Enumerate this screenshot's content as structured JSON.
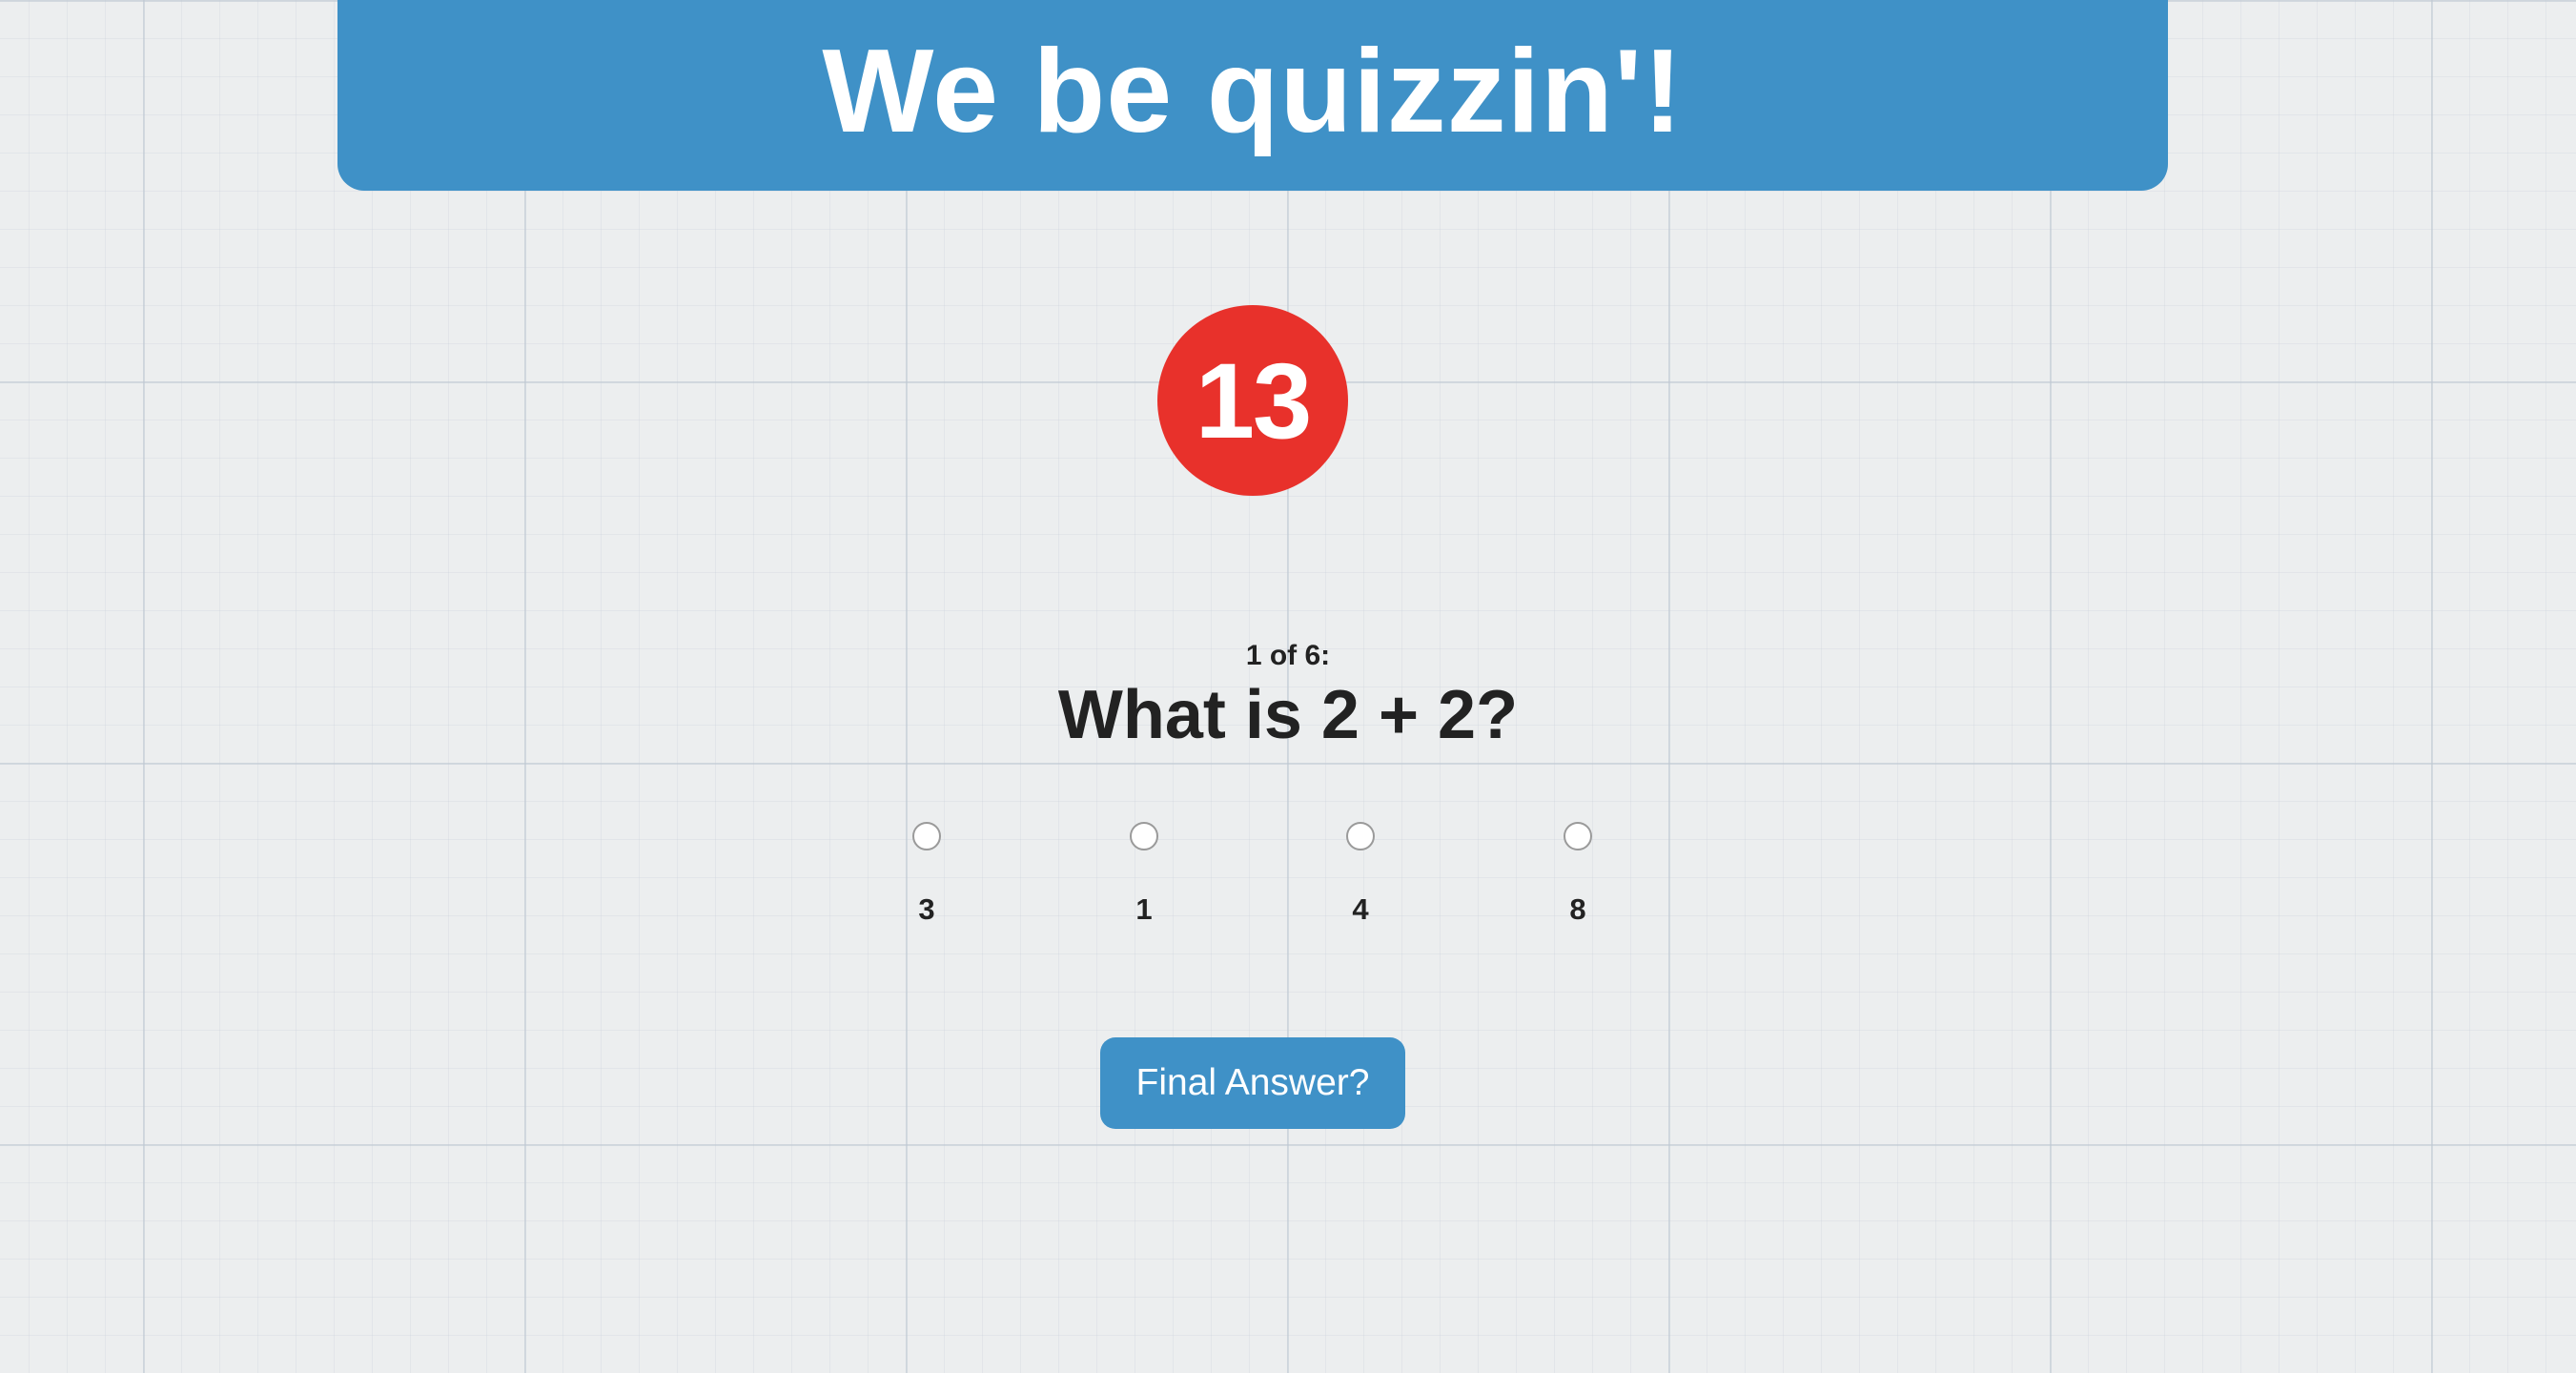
{
  "header": {
    "title": "We be quizzin'!"
  },
  "timer": {
    "value": "13"
  },
  "question": {
    "counter": "1 of 6:",
    "text": "What is 2 + 2?"
  },
  "answers": [
    {
      "label": "3",
      "selected": false
    },
    {
      "label": "1",
      "selected": false
    },
    {
      "label": "4",
      "selected": false
    },
    {
      "label": "8",
      "selected": false
    }
  ],
  "submit": {
    "label": "Final Answer?"
  },
  "colors": {
    "banner": "#3f91c7",
    "timer": "#e8312b",
    "button": "#3f91c7",
    "text": "#222222",
    "background": "#eceeef"
  }
}
